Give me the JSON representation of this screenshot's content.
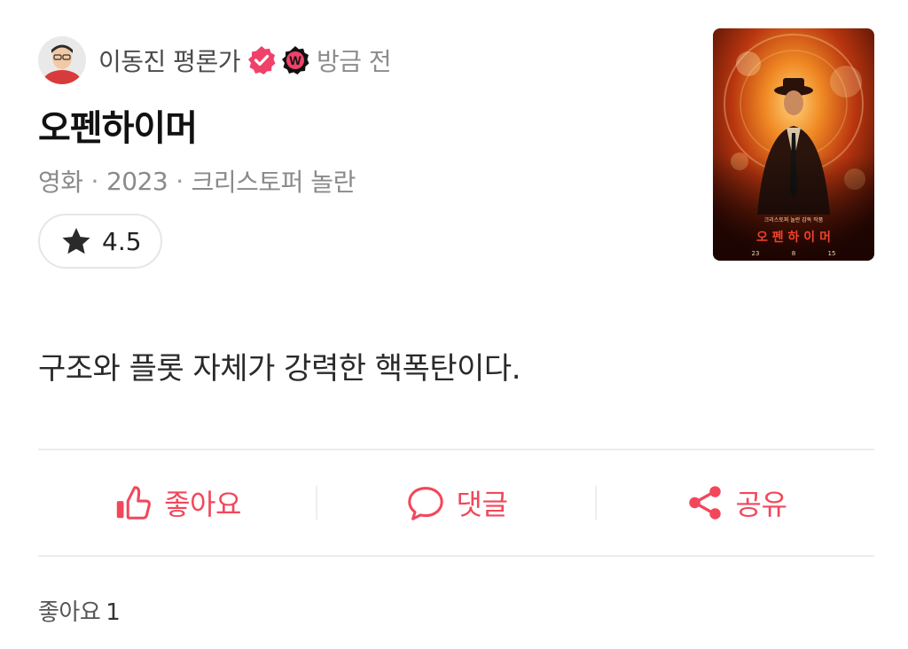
{
  "post": {
    "author": "이동진 평론가",
    "time": "방금 전",
    "badge_letter": "W"
  },
  "movie": {
    "title": "오펜하이머",
    "category": "영화",
    "year": "2023",
    "director": "크리스토퍼 놀란",
    "rating": "4.5"
  },
  "poster": {
    "title_text": "오 펜 하 이 머",
    "tagline": "크리스토퍼 놀란 감독 작품",
    "date_parts": [
      "23",
      "8",
      "15"
    ]
  },
  "review": {
    "text": "구조와 플롯 자체가 강력한 핵폭탄이다."
  },
  "actions": {
    "like_label": "좋아요",
    "comment_label": "댓글",
    "share_label": "공유"
  },
  "likes": {
    "label": "좋아요",
    "count": "1"
  },
  "colors": {
    "accent": "#f2475b",
    "verified": "#f0416a",
    "muted_text": "#8a8a8a"
  }
}
